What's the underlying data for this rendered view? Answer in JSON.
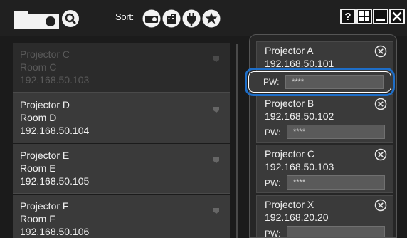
{
  "toolbar": {
    "sort_label": "Sort:",
    "icons": [
      "projector-icon",
      "search-icon",
      "sort-projector-icon",
      "sort-building-icon",
      "sort-plug-icon",
      "sort-star-icon"
    ],
    "window_buttons": {
      "help": "?",
      "grid": "grid-icon",
      "minimize": "minimize-icon",
      "close": "close-icon"
    }
  },
  "left_list": [
    {
      "name": "Projector C",
      "room": "Room C",
      "ip": "192.168.50.103",
      "offline": true
    },
    {
      "name": "Projector D",
      "room": "Room D",
      "ip": "192.168.50.104",
      "offline": false
    },
    {
      "name": "Projector E",
      "room": "Room E",
      "ip": "192.168.50.105",
      "offline": false
    },
    {
      "name": "Projector F",
      "room": "Room F",
      "ip": "192.168.50.106",
      "offline": false
    }
  ],
  "right_list": [
    {
      "name": "Projector A",
      "ip": "192.168.50.101",
      "pw_label": "PW:",
      "pw_value": "****"
    },
    {
      "name": "Projector B",
      "ip": "192.168.50.102",
      "pw_label": "PW:",
      "pw_value": "****"
    },
    {
      "name": "Projector C",
      "ip": "192.168.50.103",
      "pw_label": "PW:",
      "pw_value": "****"
    },
    {
      "name": "Projector X",
      "ip": "192.168.20.20",
      "pw_label": "PW:",
      "pw_value": ""
    }
  ],
  "colors": {
    "highlight": "#1e6ec8",
    "background": "#1b1b1b",
    "item": "#3a3a3a"
  }
}
